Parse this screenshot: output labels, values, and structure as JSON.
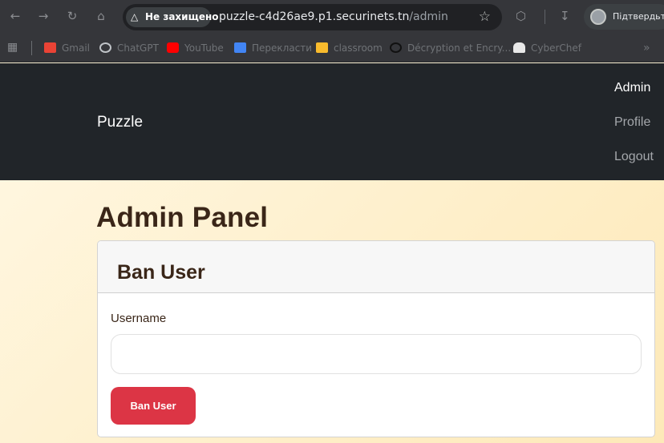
{
  "browser": {
    "security_label": "Не захищено",
    "url_host": "puzzle-c4d26ae9.p1.securinets.tn",
    "url_path": "/admin",
    "profile_label": "Підтвердьте"
  },
  "bookmarks": [
    {
      "label": "Gmail",
      "icon": "gmail-icon",
      "color": "#ea4335"
    },
    {
      "label": "ChatGPT",
      "icon": "chatgpt-icon",
      "color": "#bfc3c7"
    },
    {
      "label": "YouTube",
      "icon": "youtube-icon",
      "color": "#ff0000"
    },
    {
      "label": "Перекласти",
      "icon": "translate-icon",
      "color": "#4285f4"
    },
    {
      "label": "classroom",
      "icon": "classroom-icon",
      "color": "#f9bb2d"
    },
    {
      "label": "Décryption et Encry...",
      "icon": "lock-search-icon",
      "color": "#111111"
    },
    {
      "label": "CyberChef",
      "icon": "chef-hat-icon",
      "color": "#e8e8e8"
    }
  ],
  "navbar": {
    "brand": "Puzzle",
    "links": [
      "Admin",
      "Profile",
      "Logout"
    ]
  },
  "main": {
    "title": "Admin Panel",
    "card_title": "Ban User",
    "field_label": "Username",
    "input_value": "",
    "input_placeholder": "",
    "button_label": "Ban User"
  },
  "colors": {
    "navbar_bg": "#212529",
    "danger": "#dc3545",
    "heading": "#3a2618",
    "page_bg_start": "#fff6df",
    "page_bg_end": "#fde9b8"
  }
}
